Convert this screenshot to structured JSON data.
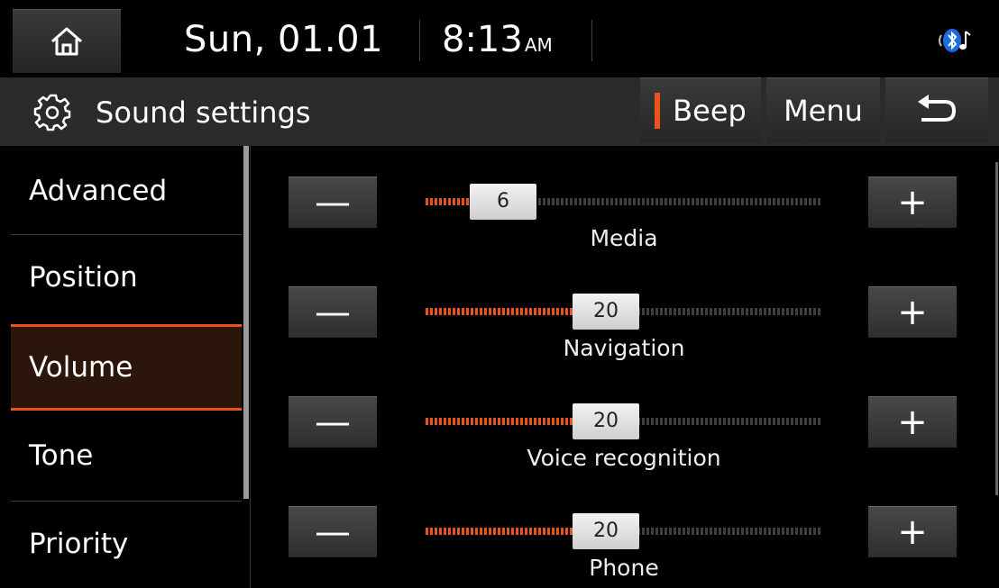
{
  "status": {
    "date": "Sun, 01.01",
    "time": "8:13",
    "ampm": "AM"
  },
  "header": {
    "title": "Sound settings",
    "beep_label": "Beep",
    "menu_label": "Menu"
  },
  "sidebar": {
    "items": [
      {
        "label": "Advanced"
      },
      {
        "label": "Position"
      },
      {
        "label": "Volume"
      },
      {
        "label": "Tone"
      },
      {
        "label": "Priority"
      }
    ],
    "selected": "Volume"
  },
  "volumes": [
    {
      "label": "Media",
      "value": "6",
      "level": 6
    },
    {
      "label": "Navigation",
      "value": "20",
      "level": 20
    },
    {
      "label": "Voice recognition",
      "value": "20",
      "level": 20
    },
    {
      "label": "Phone",
      "value": "20",
      "level": 20
    }
  ],
  "volume_max": 45,
  "colors": {
    "accent": "#e8541a",
    "background": "#000000",
    "title_bar": "#2b2b2b",
    "selected_bg": "#2c160c"
  }
}
